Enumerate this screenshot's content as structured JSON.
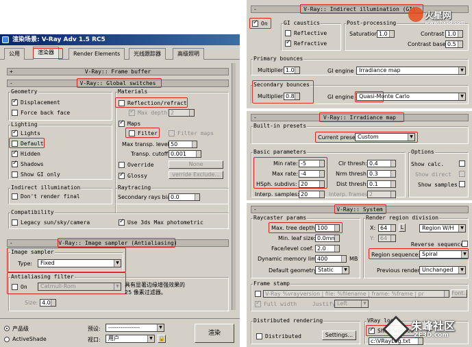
{
  "window": {
    "title": "渲染场景: V-Ray Adv 1.5 RC5"
  },
  "tabs": [
    "公用",
    "渲染器",
    "Render Elements",
    "光线跟踪器",
    "高级照明"
  ],
  "rollouts": {
    "frame_buffer": "V-Ray:: Frame buffer",
    "global_switches": "V-Ray:: Global switches",
    "image_sampler": "V-Ray:: Image sampler (Antialiasing)",
    "indirect_illumination": "V-Ray:: Indirect illumination (GI)",
    "irradiance_map": "V-Ray:: Irradiance map",
    "system": "V-Ray:: System"
  },
  "geometry": {
    "title": "Geometry",
    "displacement": "Displacement",
    "force_back_face": "Force back face"
  },
  "materials": {
    "title": "Materials",
    "reflection": "Reflection/refract",
    "max_depth": "Max depth",
    "max_depth_val": "2",
    "maps": "Maps",
    "filter": "Filter",
    "filter_maps": "Filter maps",
    "max_transp": "Max transp. levels",
    "max_transp_val": "50",
    "transp_cutoff": "Transp. cutoff",
    "transp_cutoff_val": "0.001",
    "override": "Override",
    "none": "None",
    "glossy": "Glossy",
    "override_exclude": "verride Exclude..."
  },
  "lighting": {
    "title": "Lighting",
    "lights": "Lights",
    "default": "Default",
    "hidden": "Hidden",
    "shadows": "Shadows",
    "show_gi_only": "Show GI only"
  },
  "indirect": {
    "title": "Indirect illumination",
    "dont_render_final": "Don't render final"
  },
  "raytracing": {
    "title": "Raytracing",
    "secondary_bias": "Secondary rays bias",
    "secondary_bias_val": "0.0"
  },
  "compat": {
    "title": "Compatibility",
    "legacy": "Legacy sun/sky/camera",
    "use_3ds": "Use 3ds Max photometric"
  },
  "sampler": {
    "title": "Image sampler",
    "type_label": "Type:",
    "type_value": "Fixed"
  },
  "aa_filter": {
    "title": "Antialiasing filter",
    "on": "On",
    "filter_value": "Catmull-Rom",
    "size_label": "Size:",
    "size_val": "4.0",
    "description": "具有显著边缘增强效果的 25 像素过滤器。"
  },
  "bottom": {
    "product": "产品级",
    "activeshade": "ActiveShade",
    "preset_label": "预设:",
    "preset_value": "----------------",
    "viewport_label": "视口:",
    "viewport_value": "用户",
    "render_button": "渲染"
  },
  "gi": {
    "on": "On",
    "caustics": "GI caustics",
    "reflective": "Reflective",
    "refractive": "Refractive",
    "post": "Post-processing",
    "saturation": "Saturation",
    "saturation_val": "1.0",
    "contrast": "Contrast",
    "contrast_val": "1.0",
    "contrast_base": "Contrast base",
    "contrast_base_val": "0.5",
    "primary": "Primary bounces",
    "multiplier": "Multiplier",
    "primary_mult": "1.0",
    "gi_engine": "GI engine",
    "primary_engine": "Irradiance map",
    "secondary": "Secondary bounces",
    "secondary_mult": "0.8",
    "secondary_engine": "Quasi-Monte Carlo"
  },
  "irr": {
    "builtin": "Built-in presets",
    "current_preset": "Current preset:",
    "preset_value": "Custom",
    "basic": "Basic parameters",
    "min_rate": "Min rate:",
    "min_rate_val": "-5",
    "max_rate": "Max rate:",
    "max_rate_val": "-4",
    "hsph": "HSph. subdivs:",
    "hsph_val": "20",
    "interp": "Interp. samples:",
    "interp_val": "20",
    "clr": "Clr thresh:",
    "clr_val": "0.4",
    "nrm": "Nrm thresh:",
    "nrm_val": "0.3",
    "dist": "Dist thresh:",
    "dist_val": "0.1",
    "interp_frames": "Interp. frames:",
    "interp_frames_val": "2",
    "options": "Options",
    "show_calc": "Show calc.",
    "show_direct": "Show direct",
    "show_samples": "Show samples"
  },
  "sys": {
    "raycaster": "Raycaster params",
    "max_tree": "Max. tree depth:",
    "max_tree_val": "100",
    "min_leaf": "Min. leaf size:",
    "min_leaf_val": "0.0mm",
    "face_level": "Face/level coef.",
    "face_level_val": "2.0",
    "dyn_mem": "Dynamic memory limit",
    "dyn_mem_val": "400",
    "mb": "MB",
    "default_geom": "Default geometry:",
    "default_geom_val": "Static",
    "region": "Render region division",
    "x": "X:",
    "x_val": "64",
    "y": "Y:",
    "y_val": "64",
    "l": "L",
    "region_wh": "Region W/H",
    "reverse": "Reverse sequence",
    "region_seq": "Region sequence:",
    "region_seq_val": "Spiral",
    "prev_render": "Previous render:",
    "prev_render_val": "Unchanged",
    "frame_stamp": "Frame stamp",
    "stamp_text": "V-Ray %vrayversion | file: %filename | frame: %frame | pr",
    "font": "Font...",
    "full_width": "Full width",
    "justify": "Justify:",
    "justify_val": "Left",
    "distributed": "Distributed rendering",
    "distributed_cb": "Distributed",
    "settings": "Settings...",
    "vray_log": "VRay log",
    "show_window": "Show window",
    "log_path": "c:\\VRayLog.txt"
  },
  "watermarks": {
    "top": "火星网",
    "top_url": "www.hxsd.com",
    "bottom": "朱峰社区",
    "bottom_url": "ZF3D.com"
  }
}
